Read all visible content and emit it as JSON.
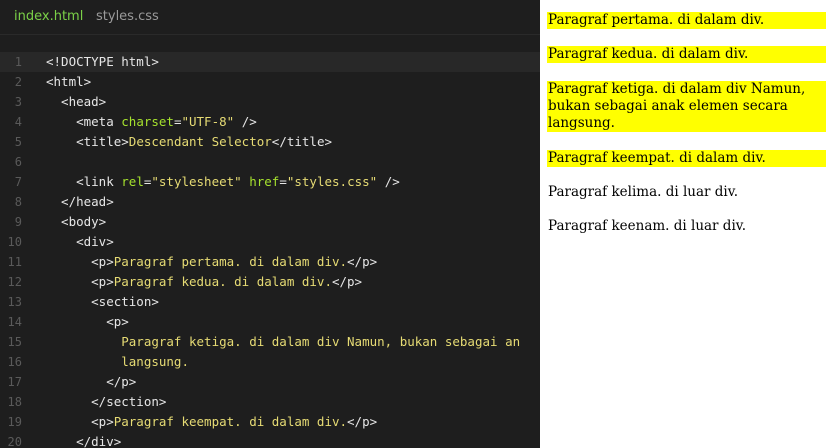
{
  "tabs": [
    "index.html",
    "styles.css"
  ],
  "code_lines": [
    {
      "n": "1",
      "hl": true,
      "parts": [
        [
          "t",
          "<!DOCTYPE html>"
        ]
      ]
    },
    {
      "n": "2",
      "parts": [
        [
          "t",
          "<html>"
        ]
      ]
    },
    {
      "n": "3",
      "parts": [
        [
          "t",
          "  <head>"
        ]
      ]
    },
    {
      "n": "4",
      "parts": [
        [
          "t",
          "    <meta "
        ],
        [
          "a",
          "charset"
        ],
        [
          "t",
          "="
        ],
        [
          "s",
          "\"UTF-8\""
        ],
        [
          "t",
          " />"
        ]
      ]
    },
    {
      "n": "5",
      "parts": [
        [
          "t",
          "    <title>"
        ],
        [
          "d",
          "Descendant Selector"
        ],
        [
          "t",
          "</title>"
        ]
      ]
    },
    {
      "n": "6",
      "parts": []
    },
    {
      "n": "7",
      "parts": [
        [
          "t",
          "    <link "
        ],
        [
          "a",
          "rel"
        ],
        [
          "t",
          "="
        ],
        [
          "s",
          "\"stylesheet\""
        ],
        [
          "t",
          " "
        ],
        [
          "a",
          "href"
        ],
        [
          "t",
          "="
        ],
        [
          "s",
          "\"styles.css\""
        ],
        [
          "t",
          " />"
        ]
      ]
    },
    {
      "n": "8",
      "parts": [
        [
          "t",
          "  </head>"
        ]
      ]
    },
    {
      "n": "9",
      "parts": [
        [
          "t",
          "  <body>"
        ]
      ]
    },
    {
      "n": "10",
      "parts": [
        [
          "t",
          "    <div>"
        ]
      ]
    },
    {
      "n": "11",
      "parts": [
        [
          "t",
          "      <p>"
        ],
        [
          "d",
          "Paragraf pertama. di dalam div."
        ],
        [
          "t",
          "</p>"
        ]
      ]
    },
    {
      "n": "12",
      "parts": [
        [
          "t",
          "      <p>"
        ],
        [
          "d",
          "Paragraf kedua. di dalam div."
        ],
        [
          "t",
          "</p>"
        ]
      ]
    },
    {
      "n": "13",
      "parts": [
        [
          "t",
          "      <section>"
        ]
      ]
    },
    {
      "n": "14",
      "parts": [
        [
          "t",
          "        <p>"
        ]
      ]
    },
    {
      "n": "15",
      "parts": [
        [
          "d",
          "          Paragraf ketiga. di dalam div Namun, bukan sebagai an"
        ]
      ]
    },
    {
      "n": "16",
      "parts": [
        [
          "d",
          "          langsung."
        ]
      ]
    },
    {
      "n": "17",
      "parts": [
        [
          "t",
          "        </p>"
        ]
      ]
    },
    {
      "n": "18",
      "parts": [
        [
          "t",
          "      </section>"
        ]
      ]
    },
    {
      "n": "19",
      "parts": [
        [
          "t",
          "      <p>"
        ],
        [
          "d",
          "Paragraf keempat. di dalam div."
        ],
        [
          "t",
          "</p>"
        ]
      ]
    },
    {
      "n": "20",
      "parts": [
        [
          "t",
          "    </div>"
        ]
      ]
    }
  ],
  "preview": [
    {
      "text": "Paragraf pertama. di dalam div.",
      "highlight": true
    },
    {
      "text": "Paragraf kedua. di dalam div.",
      "highlight": true
    },
    {
      "text": "Paragraf ketiga. di dalam div Namun, bukan sebagai anak elemen secara langsung.",
      "highlight": true
    },
    {
      "text": "Paragraf keempat. di dalam div.",
      "highlight": true
    },
    {
      "text": "Paragraf kelima. di luar div.",
      "highlight": false
    },
    {
      "text": "Paragraf keenam. di luar div.",
      "highlight": false
    }
  ],
  "colors": {
    "highlight": "#ffff00",
    "tab_active": "#7bd148",
    "editor_bg": "#1e1e1e"
  }
}
